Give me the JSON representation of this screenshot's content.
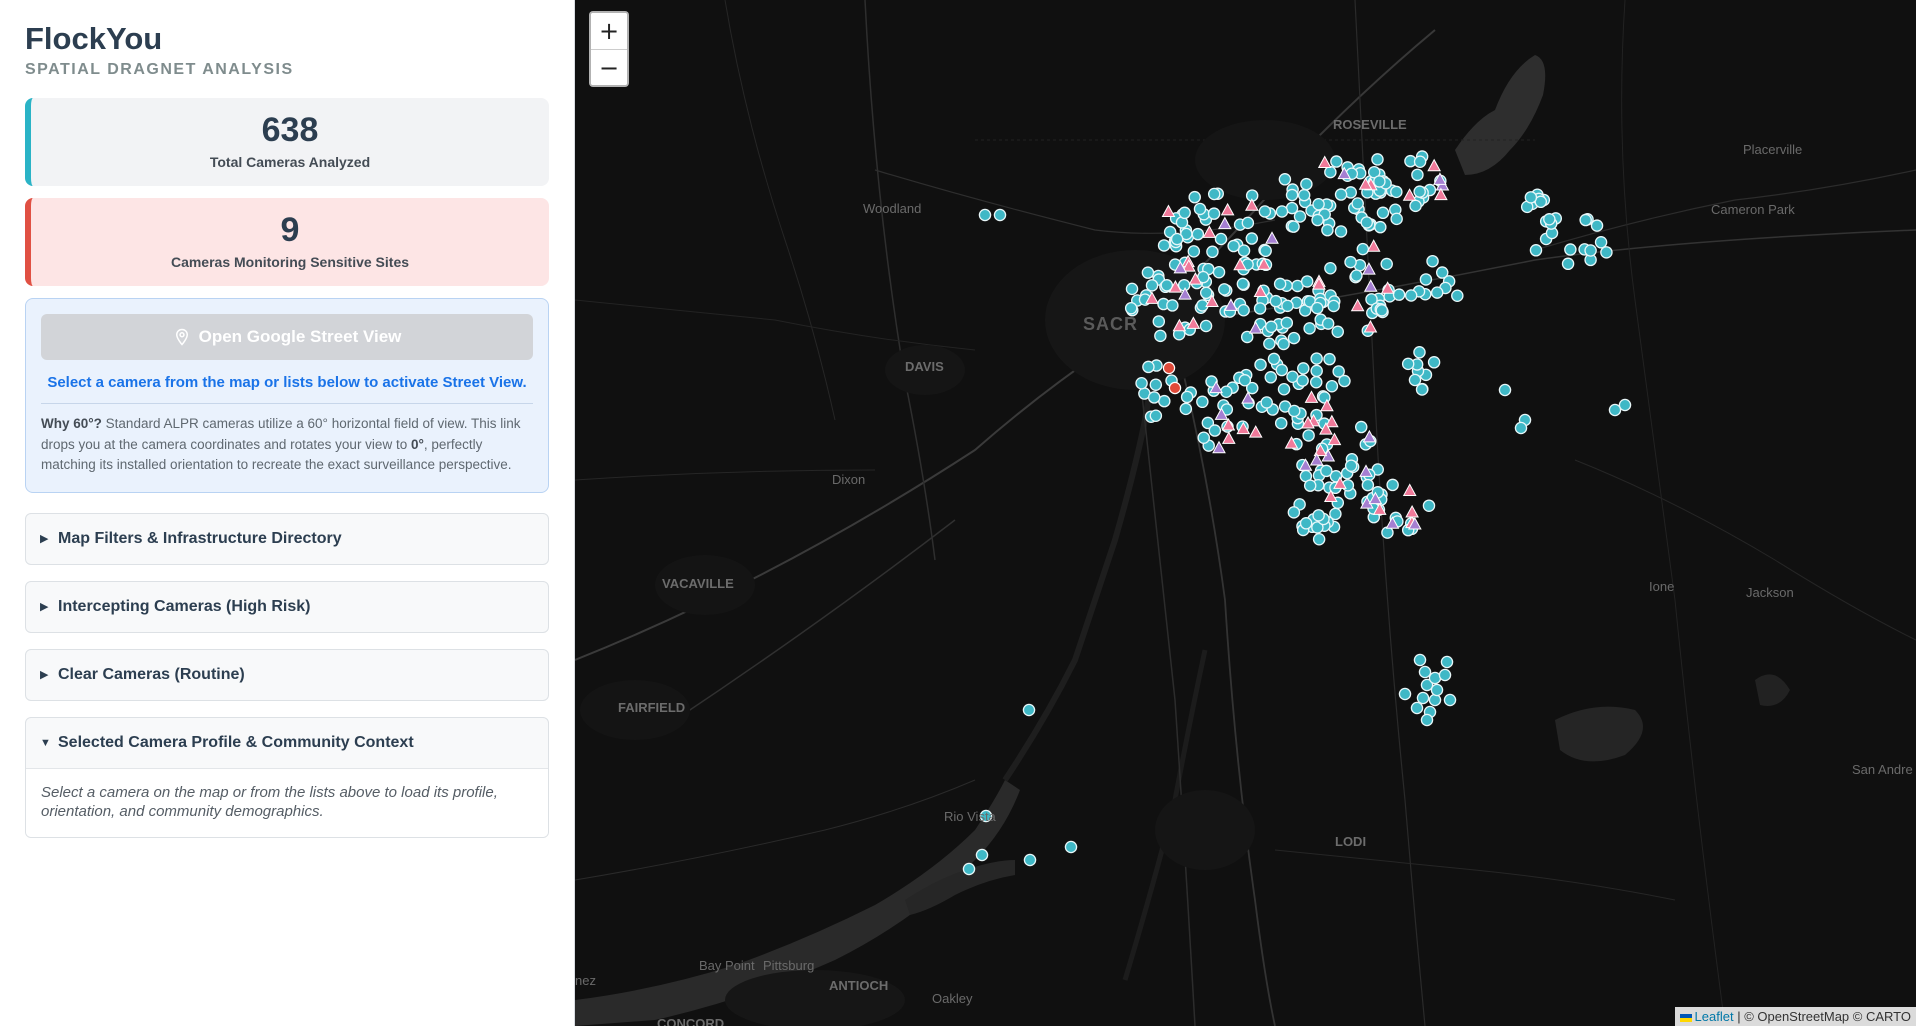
{
  "header": {
    "title": "FlockYou",
    "subtitle": "SPATIAL DRAGNET ANALYSIS"
  },
  "stats": {
    "total": {
      "value": "638",
      "label": "Total Cameras Analyzed"
    },
    "sensitive": {
      "value": "9",
      "label": "Cameras Monitoring Sensitive Sites"
    }
  },
  "street_view": {
    "button_label": "Open Google Street View",
    "hint": "Select a camera from the map or lists below to activate Street View.",
    "note_lead": "Why 60°?",
    "note_text_1": " Standard ALPR cameras utilize a 60° horizontal field of view. This link drops you at the camera coordinates and rotates your view to ",
    "note_bold_angle": "0°",
    "note_text_2": ", perfectly matching its installed orientation to recreate the exact surveillance perspective."
  },
  "accordions": [
    {
      "label": "Map Filters & Infrastructure Directory",
      "expanded": false
    },
    {
      "label": "Intercepting Cameras (High Risk)",
      "expanded": false
    },
    {
      "label": "Clear Cameras (Routine)",
      "expanded": false
    },
    {
      "label": "Selected Camera Profile & Community Context",
      "expanded": true,
      "body": "Select a camera on the map or from the lists above to load its profile, orientation, and community demographics."
    }
  ],
  "map": {
    "zoom_in": "+",
    "zoom_out": "−",
    "attribution_leaflet": "Leaflet",
    "attribution_rest": " | © OpenStreetMap © CARTO",
    "labels": {
      "roseville": "ROSEVILLE",
      "woodland": "Woodland",
      "placerville": "Placerville",
      "cameron_park": "Cameron Park",
      "sacramento": "SACR",
      "davis": "DAVIS",
      "dixon": "Dixon",
      "vacaville": "VACAVILLE",
      "ione": "Ione",
      "jackson": "Jackson",
      "fairfield": "FAIRFIELD",
      "san_andreas": "San Andre",
      "rio_vista": "Rio Vista",
      "lodi": "LODI",
      "bay_point": "Bay Point",
      "pittsburg": "Pittsburg",
      "antioch": "ANTIOCH",
      "oakley": "Oakley",
      "concord": "CONCORD",
      "martinez": "nez"
    },
    "colors": {
      "camera": "#3fb8c6",
      "camera_stroke": "#e8f7f9",
      "sensitive_pink": "#f07a9a",
      "sensitive_purple": "#a57fd1",
      "highlight_red": "#e04a3a"
    }
  }
}
